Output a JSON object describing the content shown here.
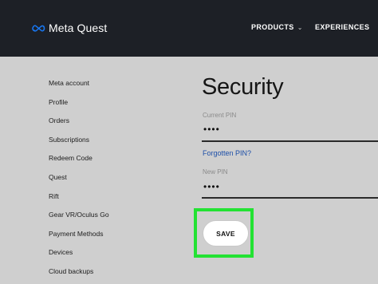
{
  "header": {
    "brand": "Meta Quest",
    "nav": [
      {
        "label": "PRODUCTS",
        "chevron": "⌄"
      },
      {
        "label": "EXPERIENCES"
      }
    ]
  },
  "sidebar": {
    "items": [
      {
        "label": "Meta account"
      },
      {
        "label": "Profile"
      },
      {
        "label": "Orders"
      },
      {
        "label": "Subscriptions"
      },
      {
        "label": "Redeem Code"
      },
      {
        "label": "Quest"
      },
      {
        "label": "Rift"
      },
      {
        "label": "Gear VR/Oculus Go"
      },
      {
        "label": "Payment Methods"
      },
      {
        "label": "Devices"
      },
      {
        "label": "Cloud backups"
      }
    ]
  },
  "main": {
    "title": "Security",
    "current_pin": {
      "label": "Current PIN",
      "value": "••••"
    },
    "forgot_link": "Forgotten PIN?",
    "new_pin": {
      "label": "New PIN",
      "value": "••••"
    },
    "save_label": "SAVE"
  },
  "colors": {
    "header_bg": "#1d2026",
    "page_bg": "#cfcfcf",
    "link": "#1d4fa8",
    "highlight": "#23e233"
  },
  "icons": {
    "brand_logo": "meta-infinity-icon"
  }
}
